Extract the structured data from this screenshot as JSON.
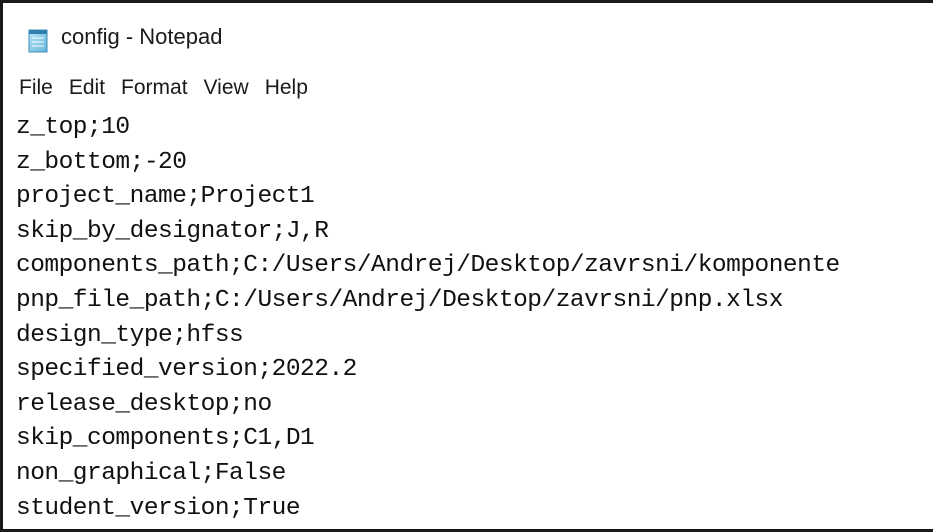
{
  "window": {
    "title": "config - Notepad",
    "icon": "notepad-icon"
  },
  "menu": {
    "items": [
      {
        "label": "File"
      },
      {
        "label": "Edit"
      },
      {
        "label": "Format"
      },
      {
        "label": "View"
      },
      {
        "label": "Help"
      }
    ]
  },
  "editor": {
    "lines": [
      "z_top;10",
      "z_bottom;-20",
      "project_name;Project1",
      "skip_by_designator;J,R",
      "components_path;C:/Users/Andrej/Desktop/zavrsni/komponente",
      "pnp_file_path;C:/Users/Andrej/Desktop/zavrsni/pnp.xlsx",
      "design_type;hfss",
      "specified_version;2022.2",
      "release_desktop;no",
      "skip_components;C1,D1",
      "non_graphical;False",
      "student_version;True"
    ]
  }
}
